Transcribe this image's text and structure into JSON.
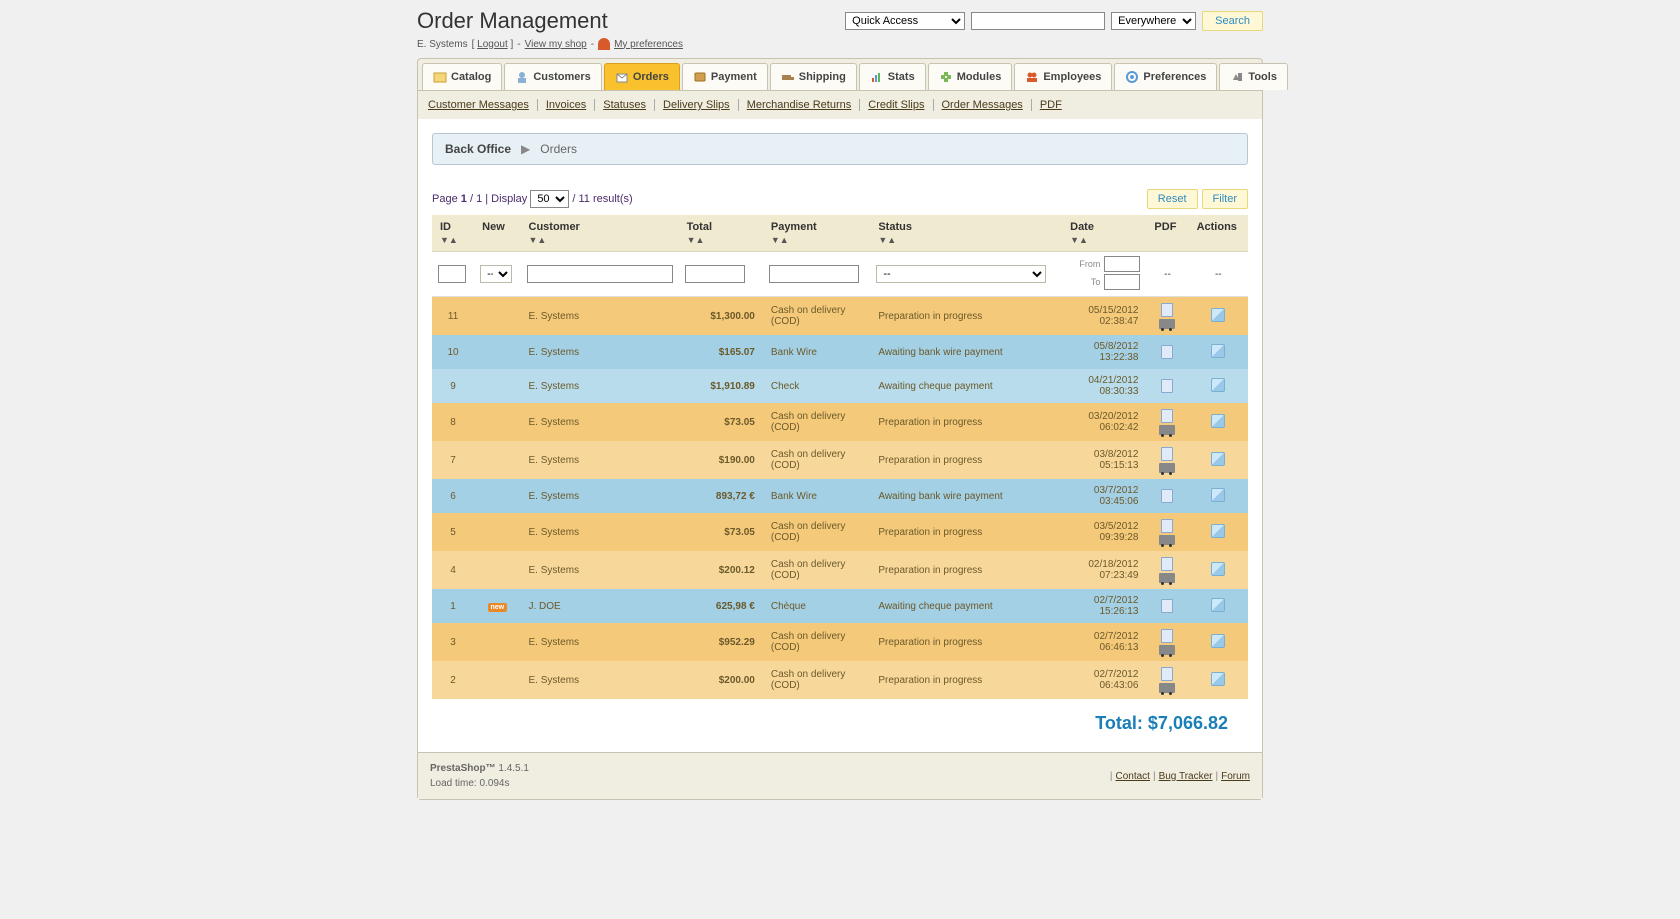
{
  "header": {
    "title": "Order Management",
    "quick_access": "Quick Access",
    "search_scope": "Everywhere",
    "search_btn": "Search"
  },
  "subheader": {
    "user": "E. Systems",
    "logout": "Logout",
    "view_shop": "View my shop",
    "my_prefs": "My preferences"
  },
  "tabs": [
    {
      "label": "Catalog"
    },
    {
      "label": "Customers"
    },
    {
      "label": "Orders"
    },
    {
      "label": "Payment"
    },
    {
      "label": "Shipping"
    },
    {
      "label": "Stats"
    },
    {
      "label": "Modules"
    },
    {
      "label": "Employees"
    },
    {
      "label": "Preferences"
    },
    {
      "label": "Tools"
    }
  ],
  "active_tab": 2,
  "subtabs": [
    "Customer Messages",
    "Invoices",
    "Statuses",
    "Delivery Slips",
    "Merchandise Returns",
    "Credit Slips",
    "Order Messages",
    "PDF"
  ],
  "breadcrumb": {
    "root": "Back Office",
    "current": "Orders"
  },
  "pagination": {
    "prefix": "Page",
    "page": "1",
    "sep": "/",
    "total_pages": "1",
    "display_label": "| Display",
    "per_page": "50",
    "results_suffix": "/ 11 result(s)"
  },
  "filter_btns": {
    "reset": "Reset",
    "filter": "Filter"
  },
  "columns": {
    "id": "ID",
    "new": "New",
    "customer": "Customer",
    "total": "Total",
    "payment": "Payment",
    "status": "Status",
    "date": "Date",
    "pdf": "PDF",
    "actions": "Actions"
  },
  "date_filter": {
    "from": "From",
    "to": "To"
  },
  "filter_placeholder": {
    "dash": "--"
  },
  "rows": [
    {
      "id": "11",
      "new": "",
      "customer": "E. Systems",
      "total": "$1,300.00",
      "payment": "Cash on delivery (COD)",
      "status": "Preparation in progress",
      "date1": "05/15/2012",
      "date2": "02:38:47",
      "cls": "row-orange",
      "truck": true
    },
    {
      "id": "10",
      "new": "",
      "customer": "E. Systems",
      "total": "$165.07",
      "payment": "Bank Wire",
      "status": "Awaiting bank wire payment",
      "date1": "05/8/2012",
      "date2": "13:22:38",
      "cls": "row-blue",
      "truck": false
    },
    {
      "id": "9",
      "new": "",
      "customer": "E. Systems",
      "total": "$1,910.89",
      "payment": "Check",
      "status": "Awaiting cheque payment",
      "date1": "04/21/2012",
      "date2": "08:30:33",
      "cls": "row-blue-alt",
      "truck": false
    },
    {
      "id": "8",
      "new": "",
      "customer": "E. Systems",
      "total": "$73.05",
      "payment": "Cash on delivery (COD)",
      "status": "Preparation in progress",
      "date1": "03/20/2012",
      "date2": "06:02:42",
      "cls": "row-orange",
      "truck": true
    },
    {
      "id": "7",
      "new": "",
      "customer": "E. Systems",
      "total": "$190.00",
      "payment": "Cash on delivery (COD)",
      "status": "Preparation in progress",
      "date1": "03/8/2012",
      "date2": "05:15:13",
      "cls": "row-orange-alt",
      "truck": true
    },
    {
      "id": "6",
      "new": "",
      "customer": "E. Systems",
      "total": "893,72 €",
      "payment": "Bank Wire",
      "status": "Awaiting bank wire payment",
      "date1": "03/7/2012",
      "date2": "03:45:06",
      "cls": "row-blue",
      "truck": false
    },
    {
      "id": "5",
      "new": "",
      "customer": "E. Systems",
      "total": "$73.05",
      "payment": "Cash on delivery (COD)",
      "status": "Preparation in progress",
      "date1": "03/5/2012",
      "date2": "09:39:28",
      "cls": "row-orange",
      "truck": true
    },
    {
      "id": "4",
      "new": "",
      "customer": "E. Systems",
      "total": "$200.12",
      "payment": "Cash on delivery (COD)",
      "status": "Preparation in progress",
      "date1": "02/18/2012",
      "date2": "07:23:49",
      "cls": "row-orange-alt",
      "truck": true
    },
    {
      "id": "1",
      "new": "new",
      "customer": "J. DOE",
      "total": "625,98 €",
      "payment": "Chèque",
      "status": "Awaiting cheque payment",
      "date1": "02/7/2012",
      "date2": "15:26:13",
      "cls": "row-blue",
      "truck": false
    },
    {
      "id": "3",
      "new": "",
      "customer": "E. Systems",
      "total": "$952.29",
      "payment": "Cash on delivery (COD)",
      "status": "Preparation in progress",
      "date1": "02/7/2012",
      "date2": "06:46:13",
      "cls": "row-orange",
      "truck": true
    },
    {
      "id": "2",
      "new": "",
      "customer": "E. Systems",
      "total": "$200.00",
      "payment": "Cash on delivery (COD)",
      "status": "Preparation in progress",
      "date1": "02/7/2012",
      "date2": "06:43:06",
      "cls": "row-orange-alt",
      "truck": true
    }
  ],
  "total": {
    "label": "Total:",
    "value": "$7,066.82"
  },
  "footer": {
    "brand": "PrestaShop™",
    "version": "1.4.5.1",
    "loadtime": "Load time: 0.094s",
    "links": [
      "Contact",
      "Bug Tracker",
      "Forum"
    ]
  }
}
